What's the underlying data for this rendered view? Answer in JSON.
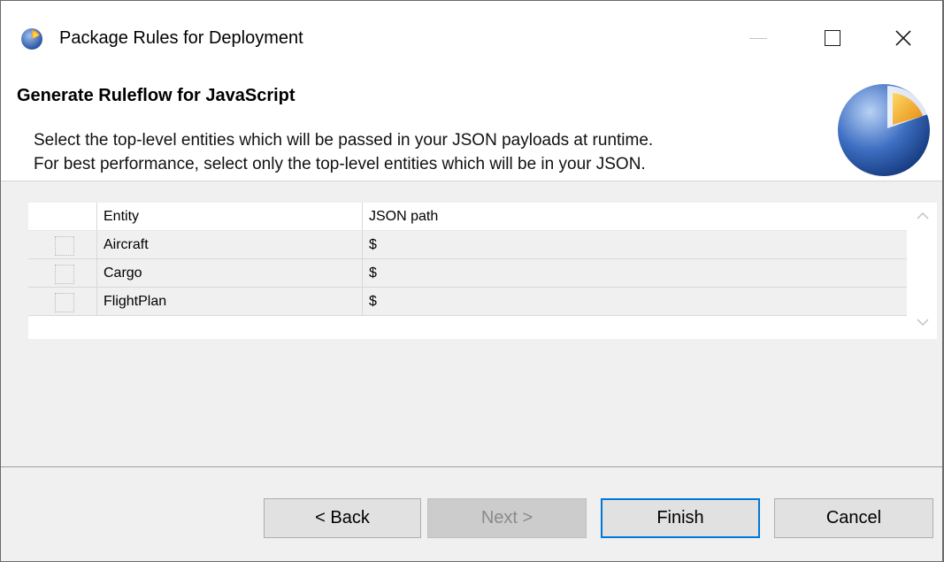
{
  "window": {
    "title": "Package Rules for Deployment"
  },
  "header": {
    "title": "Generate Ruleflow for JavaScript",
    "description_line1": "Select the top-level entities which will be passed in your JSON payloads at runtime.",
    "description_line2": "For best performance, select only the top-level entities which will be in your JSON."
  },
  "table": {
    "columns": [
      "",
      "Entity",
      "JSON path"
    ],
    "rows": [
      {
        "checked": false,
        "entity": "Aircraft",
        "json_path": "$"
      },
      {
        "checked": false,
        "entity": "Cargo",
        "json_path": "$"
      },
      {
        "checked": false,
        "entity": "FlightPlan",
        "json_path": "$"
      }
    ]
  },
  "buttons": {
    "back": "< Back",
    "next": "Next >",
    "finish": "Finish",
    "cancel": "Cancel"
  },
  "colors": {
    "accent": "#0078d7",
    "logo_blue": "#2f5fb0",
    "logo_orange": "#f0a020"
  },
  "icons": {
    "app": "app-logo-icon",
    "minimize": "minimize-icon",
    "maximize": "maximize-icon",
    "close": "close-icon",
    "wizard": "wizard-banner-icon",
    "scroll_up": "chevron-up-icon",
    "scroll_down": "chevron-down-icon"
  }
}
